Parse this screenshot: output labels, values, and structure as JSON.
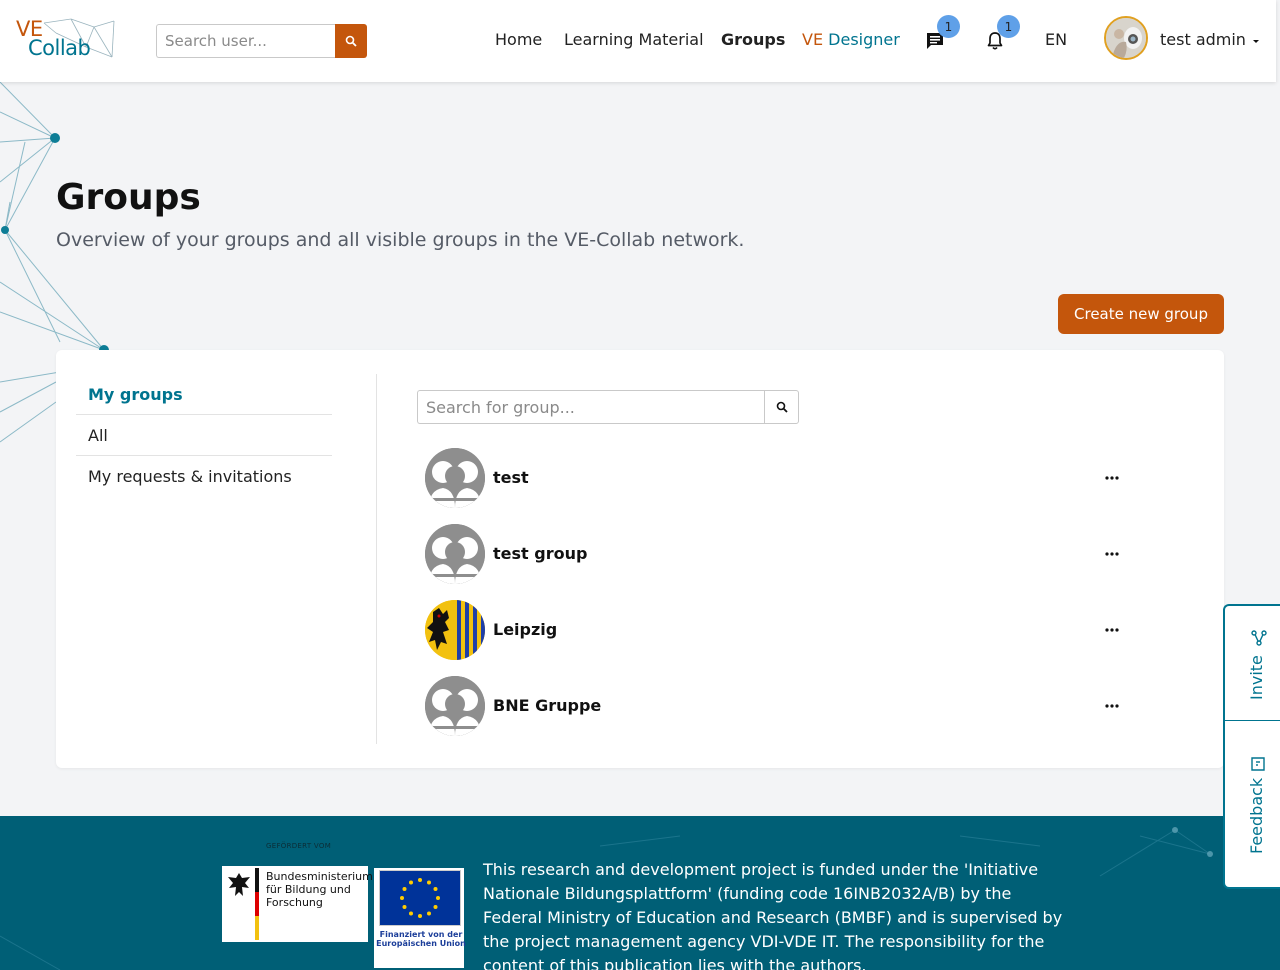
{
  "brand": {
    "logo_ve": "VE",
    "logo_collab": "Collab",
    "accent": "#c4560c",
    "primary": "#00748f",
    "footer_bg": "#005f76"
  },
  "navbar": {
    "user_search_placeholder": "Search user...",
    "links": {
      "home": "Home",
      "learning_material": "Learning Material",
      "groups": "Groups",
      "ve_designer_ve": "VE",
      "ve_designer_label": "Designer"
    },
    "chat_badge": "1",
    "notification_badge": "1",
    "language": "EN",
    "user_name": "test admin"
  },
  "page": {
    "title": "Groups",
    "subtitle": "Overview of your groups and all visible groups in the VE-Collab network.",
    "create_button": "Create new group"
  },
  "sidebar": {
    "items": [
      {
        "label": "My groups",
        "active": true
      },
      {
        "label": "All",
        "active": false
      },
      {
        "label": "My requests & invitations",
        "active": false
      }
    ]
  },
  "group_search": {
    "placeholder": "Search for group..."
  },
  "groups": [
    {
      "name": "test",
      "avatar": "default"
    },
    {
      "name": "test group",
      "avatar": "default"
    },
    {
      "name": "Leipzig",
      "avatar": "coat-of-arms"
    },
    {
      "name": "BNE Gruppe",
      "avatar": "default"
    }
  ],
  "side_tabs": {
    "invite": "Invite",
    "feedback": "Feedback"
  },
  "footer": {
    "funded_label": "GEFÖRDERT VOM",
    "bmbf_name": "Bundesministerium für Bildung und Forschung",
    "eu_caption": "Finanziert von der Europäischen Union",
    "text": "This research and development project is funded under the 'Initiative Nationale Bildungsplattform' (funding code 16INB2032A/B) by the Federal Ministry of Education and Research (BMBF) and is supervised by the project management agency VDI-VDE IT. The responsibility for the content of this publication lies with the authors."
  }
}
